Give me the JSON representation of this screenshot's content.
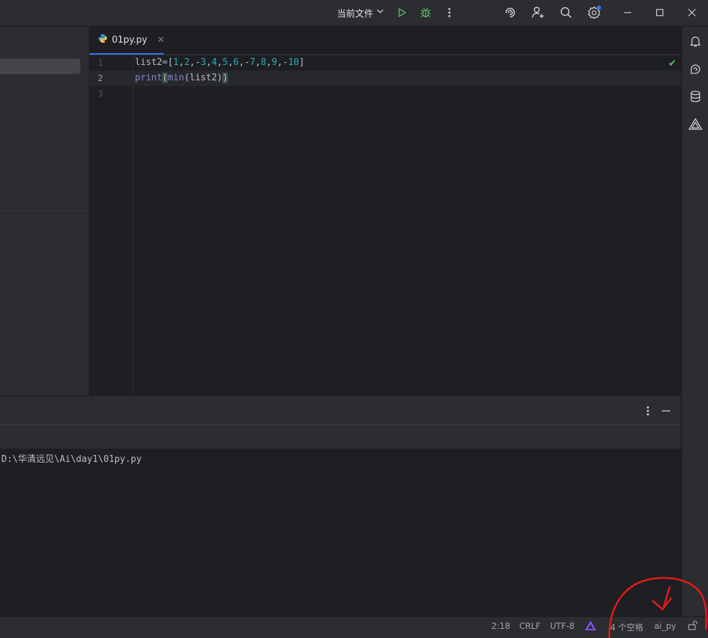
{
  "titlebar": {
    "run_config_label": "当前文件",
    "icons": [
      "chevron-down-icon",
      "run-icon",
      "debug-icon",
      "more-vertical-icon",
      "ai-assistant-icon",
      "add-user-icon",
      "search-icon",
      "settings-icon",
      "minimize-icon",
      "maximize-icon",
      "close-icon"
    ]
  },
  "editor": {
    "tab_label": "01py.py",
    "tab_icon": "python-file-icon",
    "line_numbers": [
      "1",
      "2",
      "3"
    ],
    "active_line": 2,
    "code": {
      "line1": {
        "prefix": "list2=[",
        "n1": "1",
        "c1": ",",
        "n2": "2",
        "c2": ",-",
        "n3": "3",
        "c3": ",",
        "n4": "4",
        "c4": ",",
        "n5": "5",
        "c5": ",",
        "n6": "6",
        "c6": ",-",
        "n7": "7",
        "c7": ",",
        "n8": "8",
        "c8": ",",
        "n9": "9",
        "c9": ",-",
        "n10": "10",
        "suffix": "]"
      },
      "line2": {
        "print": "print",
        "open1": "(",
        "min": "min",
        "args": "(list2)",
        "close1": ")"
      }
    },
    "inspection_status_icon": "checkmark-icon"
  },
  "right_strip": {
    "icons": [
      "notifications-icon",
      "ai-chat-icon",
      "database-icon",
      "plugin-icon"
    ]
  },
  "run_panel": {
    "console_line": "D:\\华清远见\\Ai\\day1\\01py.py",
    "icons": [
      "more-vertical-icon",
      "minimize-panel-icon"
    ]
  },
  "statusbar": {
    "position": "2:18",
    "line_separator": "CRLF",
    "encoding": "UTF-8",
    "indent": "4 个空格",
    "interpreter": "ai_py"
  },
  "colors": {
    "background": "#1e1f22",
    "panel": "#2b2d30",
    "accent": "#3574f0",
    "number": "#2aacb8",
    "builtin": "#8888c6",
    "run_green": "#5fb865",
    "annotation_red": "#e8191b"
  }
}
